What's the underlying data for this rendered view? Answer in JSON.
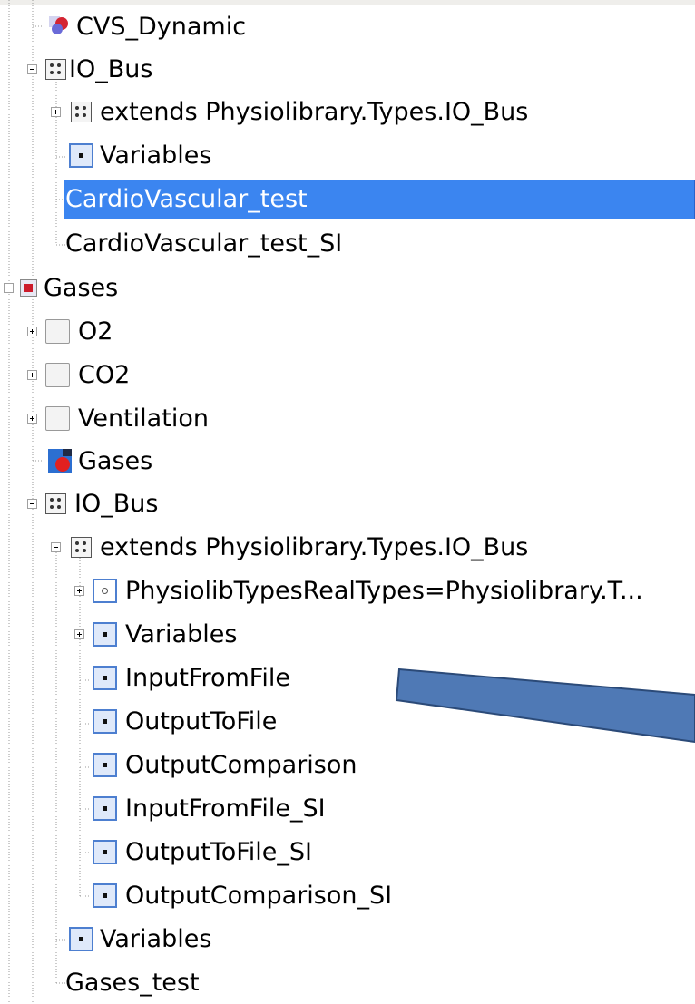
{
  "tree": {
    "items": [
      {
        "label": "CVS_Dynamic",
        "icon": "model-heart-icon"
      },
      {
        "label": "IO_Bus",
        "icon": "bus-connector-icon",
        "expanded": true
      },
      {
        "label": "extends Physiolibrary.Types.IO_Bus",
        "icon": "bus-connector-icon",
        "expanded": false
      },
      {
        "label": "Variables",
        "icon": "variable-icon"
      },
      {
        "label": "CardioVascular_test",
        "icon": "",
        "selected": true
      },
      {
        "label": "CardioVascular_test_SI",
        "icon": ""
      },
      {
        "label": "Gases",
        "icon": "package-icon",
        "expanded": true
      },
      {
        "label": "O2",
        "icon": "blank-package-icon",
        "expanded": false
      },
      {
        "label": "CO2",
        "icon": "blank-package-icon",
        "expanded": false
      },
      {
        "label": "Ventilation",
        "icon": "blank-package-icon",
        "expanded": false
      },
      {
        "label": "Gases",
        "icon": "model-gases-icon"
      },
      {
        "label": "IO_Bus",
        "icon": "bus-connector-icon",
        "expanded": true
      },
      {
        "label": "extends Physiolibrary.Types.IO_Bus",
        "icon": "bus-connector-icon",
        "expanded": true
      },
      {
        "label": "PhysiolibTypesRealTypes=Physiolibrary.T...",
        "icon": "type-icon",
        "expanded": false
      },
      {
        "label": "Variables",
        "icon": "variable-icon",
        "expanded": false
      },
      {
        "label": "InputFromFile",
        "icon": "variable-icon"
      },
      {
        "label": "OutputToFile",
        "icon": "variable-icon"
      },
      {
        "label": "OutputComparison",
        "icon": "variable-icon"
      },
      {
        "label": "InputFromFile_SI",
        "icon": "variable-icon"
      },
      {
        "label": "OutputToFile_SI",
        "icon": "variable-icon"
      },
      {
        "label": "OutputComparison_SI",
        "icon": "variable-icon"
      },
      {
        "label": "Variables",
        "icon": "variable-icon"
      },
      {
        "label": "Gases_test",
        "icon": ""
      }
    ]
  },
  "annotation": {
    "arrow_color": "#4f79b5",
    "arrow_icon": "arrow-annotation-icon"
  },
  "colors": {
    "selection": "#3b85f0",
    "variable_icon_border": "#4d7fd0"
  }
}
